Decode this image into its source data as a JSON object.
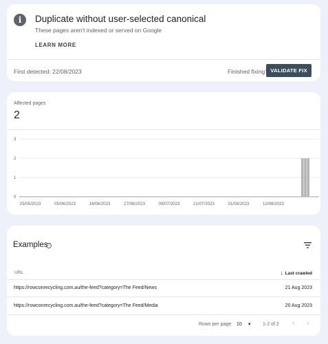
{
  "issue": {
    "title": "Duplicate without user-selected canonical",
    "subtitle": "These pages aren't indexed or served on Google",
    "learn_more": "LEARN MORE",
    "first_detected": "First detected: 22/08/2023",
    "finished_fixing": "Finished fixing?",
    "validate_label": "VALIDATE FIX",
    "icon": "info-icon"
  },
  "affected": {
    "label": "Affected pages",
    "value": "2"
  },
  "chart_data": {
    "type": "bar",
    "title": "",
    "xlabel": "",
    "ylabel": "",
    "ylim": [
      0,
      3
    ],
    "y_ticks": [
      "0",
      "1",
      "2",
      "3"
    ],
    "x_tick_labels": [
      "25/05/2023",
      "05/06/2023",
      "16/06/2023",
      "27/06/2023",
      "09/07/2023",
      "21/07/2023",
      "01/08/2023",
      "12/08/2023"
    ],
    "categories": [
      "22/08/2023",
      "23/08/2023",
      "24/08/2023"
    ],
    "values": [
      2,
      2,
      2
    ],
    "grid": true,
    "bar_color": "#b5b5b5"
  },
  "examples": {
    "title": "Examples",
    "col_url": "URL",
    "col_last_crawled": "Last crawled",
    "rows": [
      {
        "url": "https://rowconrecycling.com.au/the-feed?category=The Feed/News",
        "date": "21 Aug 2023"
      },
      {
        "url": "https://rowconrecycling.com.au/the-feed?category=The Feed/Media",
        "date": "20 Aug 2023"
      }
    ],
    "rows_per_page_label": "Rows per page:",
    "rows_per_page": "10",
    "range": "1-2 of 2"
  },
  "colors": {
    "background": "#eef0fa",
    "card": "#ffffff",
    "validate_button": "#3c4e5c",
    "bar": "#b5b5b5"
  }
}
